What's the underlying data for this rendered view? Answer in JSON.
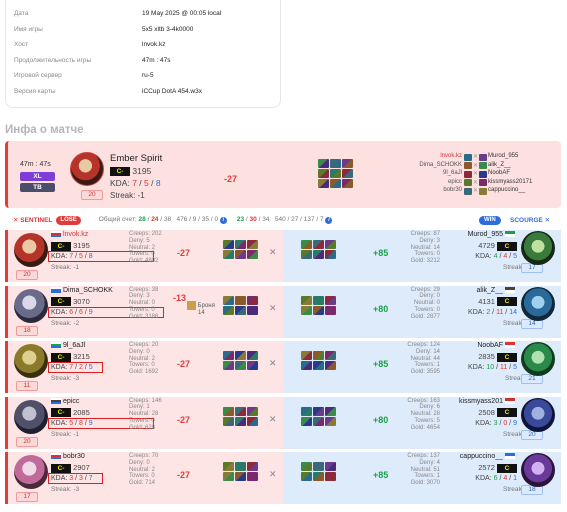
{
  "info": {
    "rows": [
      {
        "key": "Дата",
        "value": "19 May 2025 @ 00:05 local"
      },
      {
        "key": "Имя игры",
        "value": "5x5 xltb 3-4k0000"
      },
      {
        "key": "Хост",
        "value": "lnvok.kz"
      },
      {
        "key": "Продолжительность игры",
        "value": "47m : 47s"
      },
      {
        "key": "Игровой сервер",
        "value": "ru-5"
      },
      {
        "key": "Версия карты",
        "value": "iCCup DotA 454.w3x"
      }
    ]
  },
  "section_title": "Инфа о матче",
  "summary": {
    "duration": "47m : 47s",
    "mode": "XL",
    "mode2": "TB",
    "level": "20",
    "hero": "Ember Spirit",
    "rank": "C-",
    "rating": "3195",
    "kda_label": "KDA: ",
    "kills": "7",
    "deaths": "5",
    "assists": "8",
    "streak": "Streak: -1",
    "delta": "-27",
    "players_left": [
      "lnvok.kz",
      "Dima_SCHOKK",
      "9l_6aJl",
      "epicc",
      "bobr30"
    ],
    "players_right": [
      "Murod_955",
      "alik_Z__",
      "NoobAF",
      "kissmyass20171",
      "cappuccino__"
    ]
  },
  "header": {
    "sentinel": "SENTINEL",
    "lose": "LOSE",
    "total_label": "Общий счет:",
    "s_kills": "28",
    "s_deaths": "24",
    "s_assists": "38",
    "s_extra": "476 / 9 / 35 / 0",
    "c_kills": "23",
    "c_deaths": "30",
    "c_assists": "34",
    "c_extra": "540 / 27 / 137 / 7",
    "win": "WIN",
    "scourge": "SCOURGE"
  },
  "players": [
    {
      "name": "lnvok.kz",
      "rank": "C-",
      "rating": "3195",
      "k": "7",
      "d": "5",
      "a": "8",
      "streak": "Streak: -1",
      "level": "20",
      "stats": [
        "Creeps: 202",
        "Deny: 5",
        "Neutral: 2",
        "Towers: 0",
        "Gold: 4802"
      ],
      "delta": "-27",
      "opp_name": "Murod_955",
      "opp_rank": "C",
      "opp_rating": "4729",
      "ok": "4",
      "od": "4",
      "oa": "5",
      "opp_streak": "Streak: 2",
      "opp_level": "17",
      "opp_stats": [
        "Creeps: 87",
        "Deny: 3",
        "Neutral: 14",
        "Towers: 0",
        "Gold: 3212"
      ],
      "opp_delta": "+85"
    },
    {
      "name": "Dima_SCHOKK",
      "rank": "C-",
      "rating": "3070",
      "k": "6",
      "d": "6",
      "a": "9",
      "streak": "Streak: -2",
      "level": "18",
      "stats": [
        "Creeps: 38",
        "Deny: 3",
        "Neutral: 0",
        "Towers: 0",
        "Gold: 3186"
      ],
      "delta": "-13",
      "extra": "Броня",
      "extra_val": "14",
      "opp_name": "alik_Z__",
      "opp_rank": "C",
      "opp_rating": "4131",
      "ok": "2",
      "od": "11",
      "oa": "14",
      "opp_streak": "Streak: 1",
      "opp_level": "14",
      "opp_stats": [
        "Creeps: 29",
        "Deny: 0",
        "Neutral: 0",
        "Towers: 0",
        "Gold: 2877"
      ],
      "opp_delta": "+80"
    },
    {
      "name": "9l_6aJl",
      "rank": "C-",
      "rating": "3215",
      "k": "7",
      "d": "2",
      "a": "5",
      "streak": "Streak: -3",
      "level": "11",
      "stats": [
        "Creeps: 20",
        "Deny: 0",
        "Neutral: 2",
        "Towers: 0",
        "Gold: 1692"
      ],
      "delta": "-27",
      "opp_name": "NoobAF",
      "opp_rank": "C",
      "opp_rating": "2835",
      "ok": "10",
      "od": "11",
      "oa": "5",
      "opp_streak": "Streak: 2",
      "opp_level": "21",
      "opp_stats": [
        "Creeps: 124",
        "Deny: 14",
        "Neutral: 44",
        "Towers: 1",
        "Gold: 3595"
      ],
      "opp_delta": "+85"
    },
    {
      "name": "epicc",
      "rank": "C-",
      "rating": "2085",
      "k": "5",
      "d": "8",
      "a": "9",
      "streak": "Streak: -1",
      "level": "20",
      "stats": [
        "Creeps: 146",
        "Deny: 1",
        "Neutral: 28",
        "Towers: 0",
        "Gold: 628"
      ],
      "delta": "-27",
      "opp_name": "kissmyass201",
      "opp_rank": "C",
      "opp_rating": "2508",
      "ok": "3",
      "od": "0",
      "oa": "9",
      "opp_streak": "Streak: 1",
      "opp_level": "20",
      "opp_stats": [
        "Creeps: 163",
        "Deny: 6",
        "Neutral: 28",
        "Towers: 5",
        "Gold: 4654"
      ],
      "opp_delta": "+80"
    },
    {
      "name": "bobr30",
      "rank": "C-",
      "rating": "2907",
      "k": "3",
      "d": "3",
      "a": "7",
      "streak": "Streak: -3",
      "level": "17",
      "stats": [
        "Creeps: 70",
        "Deny: 0",
        "Neutral: 2",
        "Towers: 0",
        "Gold: 714"
      ],
      "delta": "-27",
      "opp_name": "cappuccino__",
      "opp_rank": "C",
      "opp_rating": "2572",
      "ok": "6",
      "od": "4",
      "oa": "1",
      "opp_streak": "Streak: 2",
      "opp_level": "18",
      "opp_stats": [
        "Creeps: 137",
        "Deny: 4",
        "Neutral: 51",
        "Towers: 1",
        "Gold: 3070"
      ],
      "opp_delta": "+85"
    }
  ]
}
